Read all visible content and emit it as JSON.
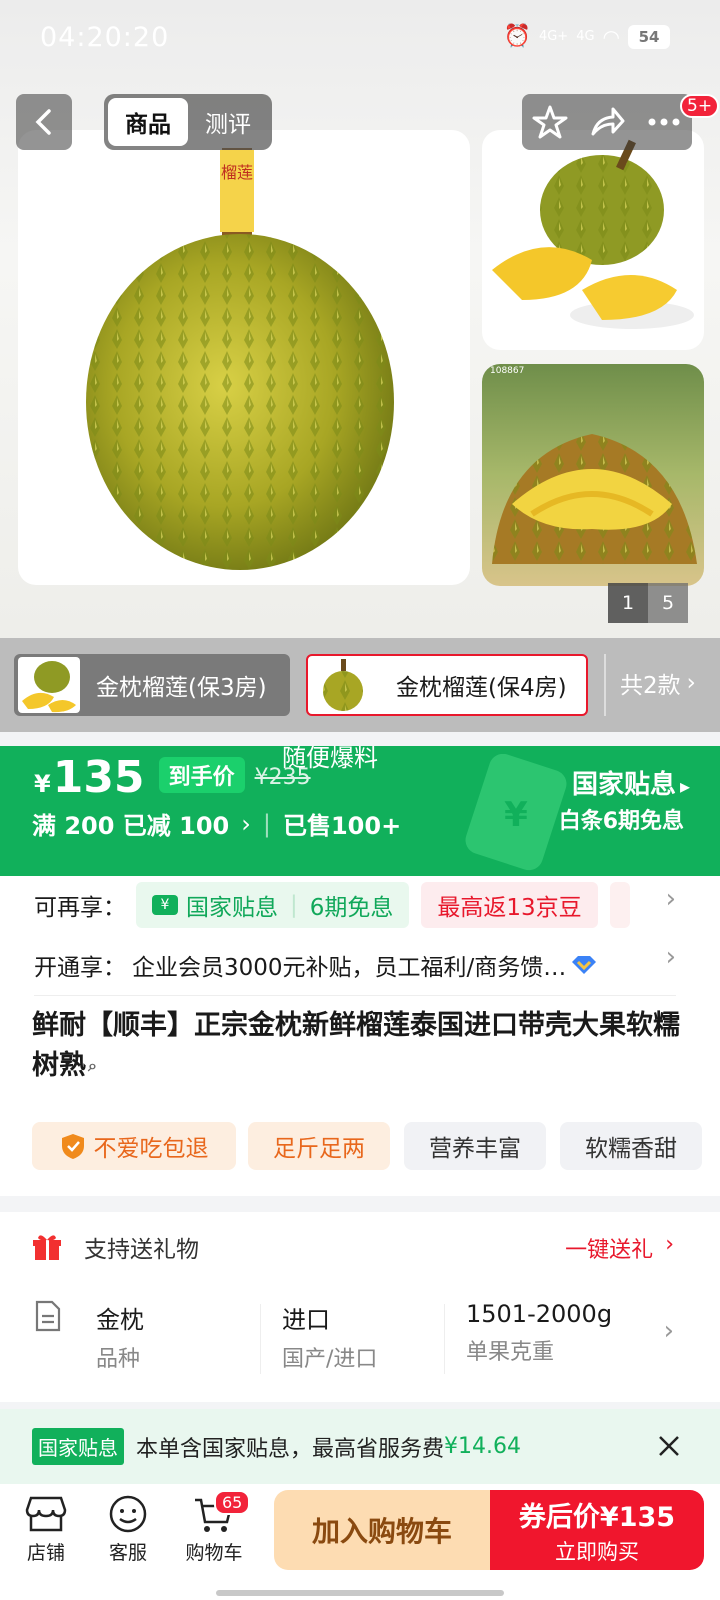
{
  "status_bar": {
    "time": "04:20:20",
    "battery": "54",
    "net1": "4G+",
    "net2": "4G"
  },
  "header": {
    "tabs": [
      "商品",
      "测评"
    ],
    "badge": "5+"
  },
  "gallery": {
    "page_current": "1",
    "page_total": "5",
    "watermark": "108867"
  },
  "variants": {
    "items": [
      {
        "label": "金枕榴莲(保3房)",
        "selected": false
      },
      {
        "label": "金枕榴莲(保4房)",
        "selected": true
      }
    ],
    "more": "共2款",
    "tube_text": "榴莲"
  },
  "price": {
    "currency": "¥",
    "amount": "135",
    "final_label": "到手价",
    "original": "¥235",
    "overlay": "随便爆料",
    "promo": "满 200 已减 100",
    "sold": "已售100+",
    "subsidy_title": "国家贴息",
    "subsidy_sub": "白条6期免息",
    "ticket_symbol": "¥"
  },
  "benefits": {
    "row1_label": "可再享：",
    "chip1": "国家贴息",
    "chip1_b": "6期免息",
    "chip2": "最高返13京豆",
    "chip1_icon": "¥",
    "row2_label": "开通享：",
    "row2_text": "企业会员3000元补贴，员工福利/商务馈…"
  },
  "product": {
    "title": "鲜耐【顺丰】正宗金枕新鲜榴莲泰国进口带壳大果软糯树熟",
    "tags": [
      "不爱吃包退",
      "足斤足两",
      "营养丰富",
      "软糯香甜"
    ]
  },
  "gift": {
    "label": "支持送礼物",
    "action": "一键送礼"
  },
  "specs": [
    {
      "value": "金枕",
      "key": "品种"
    },
    {
      "value": "进口",
      "key": "国产/进口"
    },
    {
      "value": "1501-2000g",
      "key": "单果克重"
    }
  ],
  "subsidy_bar": {
    "tag": "国家贴息",
    "text": "本单含国家贴息，最高省服务费",
    "amount": "¥14.64"
  },
  "bottom": {
    "shop": "店铺",
    "service": "客服",
    "cart": "购物车",
    "cart_badge": "65",
    "add_cart": "加入购物车",
    "buy_price": "券后价¥135",
    "buy_now": "立即购买"
  },
  "colors": {
    "green": "#11b05b",
    "red": "#e8182c",
    "orange_btn": "#fde0b8",
    "accent_red": "#f23030"
  }
}
